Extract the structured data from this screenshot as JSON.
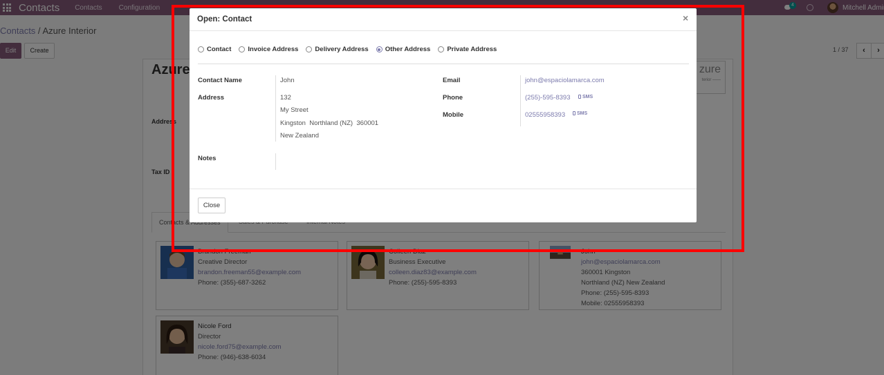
{
  "navbar": {
    "brand": "Contacts",
    "links": [
      "Contacts",
      "Configuration"
    ],
    "chat_badge": "4",
    "user_name": "Mitchell Admin"
  },
  "control": {
    "breadcrumb_root": "Contacts",
    "breadcrumb_sep": " / ",
    "breadcrumb_current": "Azure Interior",
    "edit_label": "Edit",
    "create_label": "Create",
    "pager": "1 / 37",
    "prev_icon": "‹",
    "next_icon": "›"
  },
  "sheet": {
    "title": "Azure",
    "logo_text": "zure",
    "logo_sub": "terior ——",
    "address_label": "Address",
    "taxid_label": "Tax ID",
    "tabs": [
      "Contacts & Addresses",
      "Sales & Purchase",
      "Internal Notes"
    ],
    "cards": [
      {
        "lines": [
          "Brandon Freeman",
          "Creative Director",
          "brandon.freeman55@example.com",
          "Phone: (355)-687-3262"
        ]
      },
      {
        "lines": [
          "Colleen Diaz",
          "Business Executive",
          "colleen.diaz83@example.com",
          "Phone: (255)-595-8393"
        ]
      },
      {
        "lines": [
          "John",
          "john@espaciolamarca.com",
          "360001 Kingston",
          "Northland (NZ) New Zealand",
          "Phone: (255)-595-8393",
          "Mobile: 02555958393"
        ]
      },
      {
        "lines": [
          "Nicole Ford",
          "Director",
          "nicole.ford75@example.com",
          "Phone: (946)-638-6034"
        ]
      }
    ]
  },
  "modal": {
    "title": "Open: Contact",
    "close_icon": "×",
    "types": [
      "Contact",
      "Invoice Address",
      "Delivery Address",
      "Other Address",
      "Private Address"
    ],
    "selected_type": "Other Address",
    "labels": {
      "contact_name": "Contact Name",
      "address": "Address",
      "notes": "Notes",
      "email": "Email",
      "phone": "Phone",
      "mobile": "Mobile"
    },
    "values": {
      "contact_name": "John",
      "street": "132",
      "street2": "My Street",
      "city": "Kingston",
      "state": "Northland (NZ)",
      "zip": "360001",
      "country": "New Zealand",
      "email": "john@espaciolamarca.com",
      "phone": "(255)-595-8393",
      "mobile": "02555958393"
    },
    "sms_label": "SMS",
    "close_button": "Close"
  },
  "colors": {
    "brand": "#875a7b",
    "link": "#7c7bad",
    "highlight": "#ff0000"
  }
}
